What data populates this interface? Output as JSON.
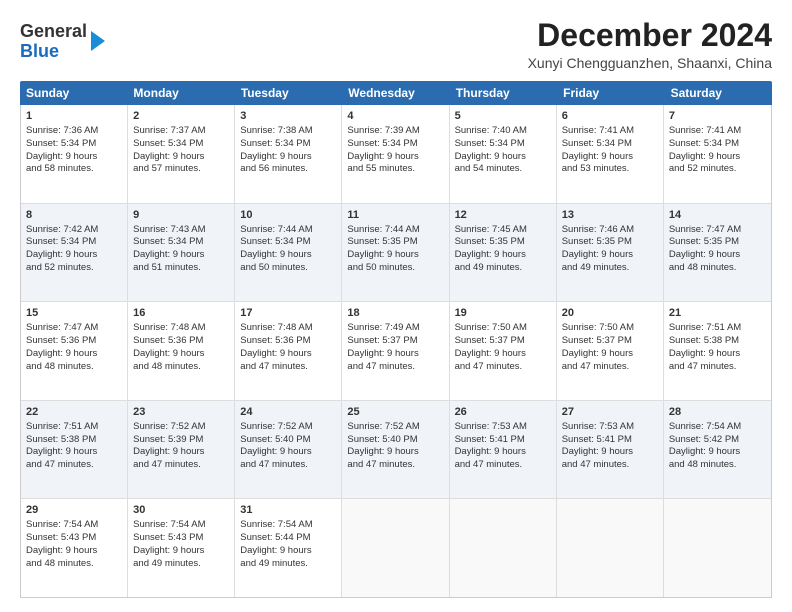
{
  "header": {
    "logo_general": "General",
    "logo_blue": "Blue",
    "title": "December 2024",
    "location": "Xunyi Chengguanzhen, Shaanxi, China"
  },
  "days": [
    "Sunday",
    "Monday",
    "Tuesday",
    "Wednesday",
    "Thursday",
    "Friday",
    "Saturday"
  ],
  "rows": [
    [
      {
        "day": "1",
        "lines": [
          "Sunrise: 7:36 AM",
          "Sunset: 5:34 PM",
          "Daylight: 9 hours",
          "and 58 minutes."
        ]
      },
      {
        "day": "2",
        "lines": [
          "Sunrise: 7:37 AM",
          "Sunset: 5:34 PM",
          "Daylight: 9 hours",
          "and 57 minutes."
        ]
      },
      {
        "day": "3",
        "lines": [
          "Sunrise: 7:38 AM",
          "Sunset: 5:34 PM",
          "Daylight: 9 hours",
          "and 56 minutes."
        ]
      },
      {
        "day": "4",
        "lines": [
          "Sunrise: 7:39 AM",
          "Sunset: 5:34 PM",
          "Daylight: 9 hours",
          "and 55 minutes."
        ]
      },
      {
        "day": "5",
        "lines": [
          "Sunrise: 7:40 AM",
          "Sunset: 5:34 PM",
          "Daylight: 9 hours",
          "and 54 minutes."
        ]
      },
      {
        "day": "6",
        "lines": [
          "Sunrise: 7:41 AM",
          "Sunset: 5:34 PM",
          "Daylight: 9 hours",
          "and 53 minutes."
        ]
      },
      {
        "day": "7",
        "lines": [
          "Sunrise: 7:41 AM",
          "Sunset: 5:34 PM",
          "Daylight: 9 hours",
          "and 52 minutes."
        ]
      }
    ],
    [
      {
        "day": "8",
        "lines": [
          "Sunrise: 7:42 AM",
          "Sunset: 5:34 PM",
          "Daylight: 9 hours",
          "and 52 minutes."
        ]
      },
      {
        "day": "9",
        "lines": [
          "Sunrise: 7:43 AM",
          "Sunset: 5:34 PM",
          "Daylight: 9 hours",
          "and 51 minutes."
        ]
      },
      {
        "day": "10",
        "lines": [
          "Sunrise: 7:44 AM",
          "Sunset: 5:34 PM",
          "Daylight: 9 hours",
          "and 50 minutes."
        ]
      },
      {
        "day": "11",
        "lines": [
          "Sunrise: 7:44 AM",
          "Sunset: 5:35 PM",
          "Daylight: 9 hours",
          "and 50 minutes."
        ]
      },
      {
        "day": "12",
        "lines": [
          "Sunrise: 7:45 AM",
          "Sunset: 5:35 PM",
          "Daylight: 9 hours",
          "and 49 minutes."
        ]
      },
      {
        "day": "13",
        "lines": [
          "Sunrise: 7:46 AM",
          "Sunset: 5:35 PM",
          "Daylight: 9 hours",
          "and 49 minutes."
        ]
      },
      {
        "day": "14",
        "lines": [
          "Sunrise: 7:47 AM",
          "Sunset: 5:35 PM",
          "Daylight: 9 hours",
          "and 48 minutes."
        ]
      }
    ],
    [
      {
        "day": "15",
        "lines": [
          "Sunrise: 7:47 AM",
          "Sunset: 5:36 PM",
          "Daylight: 9 hours",
          "and 48 minutes."
        ]
      },
      {
        "day": "16",
        "lines": [
          "Sunrise: 7:48 AM",
          "Sunset: 5:36 PM",
          "Daylight: 9 hours",
          "and 48 minutes."
        ]
      },
      {
        "day": "17",
        "lines": [
          "Sunrise: 7:48 AM",
          "Sunset: 5:36 PM",
          "Daylight: 9 hours",
          "and 47 minutes."
        ]
      },
      {
        "day": "18",
        "lines": [
          "Sunrise: 7:49 AM",
          "Sunset: 5:37 PM",
          "Daylight: 9 hours",
          "and 47 minutes."
        ]
      },
      {
        "day": "19",
        "lines": [
          "Sunrise: 7:50 AM",
          "Sunset: 5:37 PM",
          "Daylight: 9 hours",
          "and 47 minutes."
        ]
      },
      {
        "day": "20",
        "lines": [
          "Sunrise: 7:50 AM",
          "Sunset: 5:37 PM",
          "Daylight: 9 hours",
          "and 47 minutes."
        ]
      },
      {
        "day": "21",
        "lines": [
          "Sunrise: 7:51 AM",
          "Sunset: 5:38 PM",
          "Daylight: 9 hours",
          "and 47 minutes."
        ]
      }
    ],
    [
      {
        "day": "22",
        "lines": [
          "Sunrise: 7:51 AM",
          "Sunset: 5:38 PM",
          "Daylight: 9 hours",
          "and 47 minutes."
        ]
      },
      {
        "day": "23",
        "lines": [
          "Sunrise: 7:52 AM",
          "Sunset: 5:39 PM",
          "Daylight: 9 hours",
          "and 47 minutes."
        ]
      },
      {
        "day": "24",
        "lines": [
          "Sunrise: 7:52 AM",
          "Sunset: 5:40 PM",
          "Daylight: 9 hours",
          "and 47 minutes."
        ]
      },
      {
        "day": "25",
        "lines": [
          "Sunrise: 7:52 AM",
          "Sunset: 5:40 PM",
          "Daylight: 9 hours",
          "and 47 minutes."
        ]
      },
      {
        "day": "26",
        "lines": [
          "Sunrise: 7:53 AM",
          "Sunset: 5:41 PM",
          "Daylight: 9 hours",
          "and 47 minutes."
        ]
      },
      {
        "day": "27",
        "lines": [
          "Sunrise: 7:53 AM",
          "Sunset: 5:41 PM",
          "Daylight: 9 hours",
          "and 47 minutes."
        ]
      },
      {
        "day": "28",
        "lines": [
          "Sunrise: 7:54 AM",
          "Sunset: 5:42 PM",
          "Daylight: 9 hours",
          "and 48 minutes."
        ]
      }
    ],
    [
      {
        "day": "29",
        "lines": [
          "Sunrise: 7:54 AM",
          "Sunset: 5:43 PM",
          "Daylight: 9 hours",
          "and 48 minutes."
        ]
      },
      {
        "day": "30",
        "lines": [
          "Sunrise: 7:54 AM",
          "Sunset: 5:43 PM",
          "Daylight: 9 hours",
          "and 49 minutes."
        ]
      },
      {
        "day": "31",
        "lines": [
          "Sunrise: 7:54 AM",
          "Sunset: 5:44 PM",
          "Daylight: 9 hours",
          "and 49 minutes."
        ]
      },
      {
        "day": "",
        "lines": []
      },
      {
        "day": "",
        "lines": []
      },
      {
        "day": "",
        "lines": []
      },
      {
        "day": "",
        "lines": []
      }
    ]
  ]
}
